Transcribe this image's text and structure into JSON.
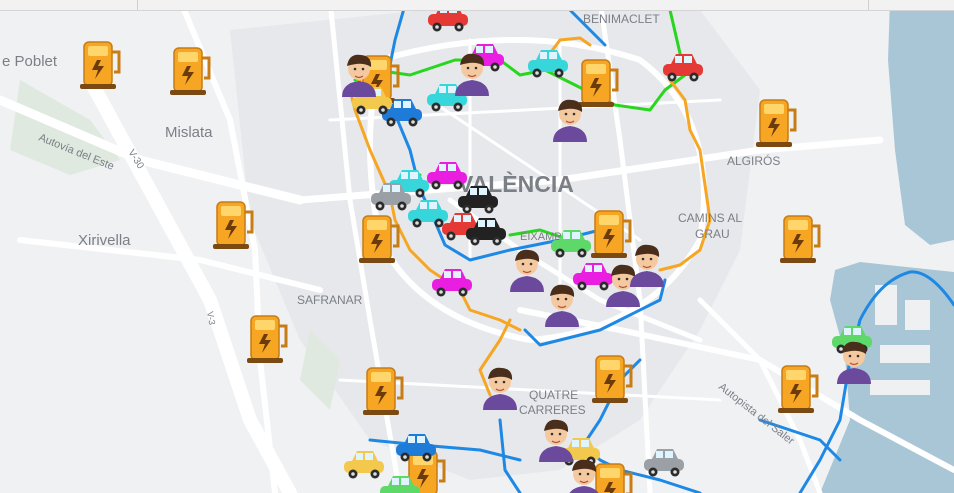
{
  "map": {
    "labels": {
      "poblet": "e Poblet",
      "mislata": "Mislata",
      "xirivella": "Xirivella",
      "safranar": "SAFRANAR",
      "benimaclet": "BENIMACLET",
      "valencia": "VALÈNCIA",
      "algiros": "ALGIRÓS",
      "camins_line1": "CAMINS AL",
      "camins_line2": "GRAU",
      "quatre_line1": "QUATRE",
      "quatre_line2": "CARRERES",
      "eixample": "EIXAMPLE",
      "autovia_este": "Autovía del Este",
      "v30": "V-30",
      "autopista_saler": "Autopista del Saler",
      "road_v3": "V-3"
    },
    "colors": {
      "water": "#a9c6d7",
      "route_blue": "#1e88e5",
      "route_green": "#29d61e",
      "route_orange": "#f6a623",
      "station": "#f6a623",
      "car_red": "#e53935",
      "car_teal": "#37d6da",
      "car_blue": "#1f7bd8",
      "car_magenta": "#e91ee0",
      "car_yellow": "#f2c94c",
      "car_grey": "#9aa0a6",
      "car_black": "#222222",
      "car_green": "#5fd86a"
    },
    "stations": [
      "charging-station-icon"
    ],
    "cars": [
      "car-icon"
    ],
    "people": [
      "person-icon"
    ]
  }
}
